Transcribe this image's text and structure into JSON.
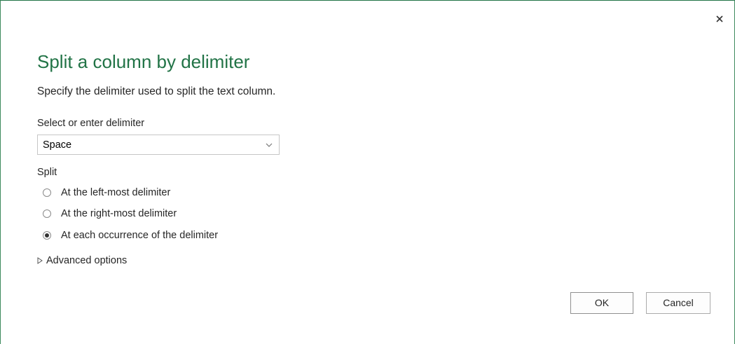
{
  "dialog": {
    "close_icon": "close-icon",
    "title": "Split a column by delimiter",
    "subtitle": "Specify the delimiter used to split the text column."
  },
  "delimiter": {
    "label": "Select or enter delimiter",
    "selected_value": "Space",
    "arrow_icon": "chevron-down-icon"
  },
  "split": {
    "label": "Split",
    "options": [
      {
        "label": "At the left-most delimiter",
        "checked": false
      },
      {
        "label": "At the right-most delimiter",
        "checked": false
      },
      {
        "label": "At each occurrence of the delimiter",
        "checked": true
      }
    ]
  },
  "advanced": {
    "label": "Advanced options",
    "icon": "expand-triangle-icon"
  },
  "buttons": {
    "ok_label": "OK",
    "cancel_label": "Cancel"
  },
  "colors": {
    "accent": "#217346",
    "border": "#3e8a5e"
  }
}
